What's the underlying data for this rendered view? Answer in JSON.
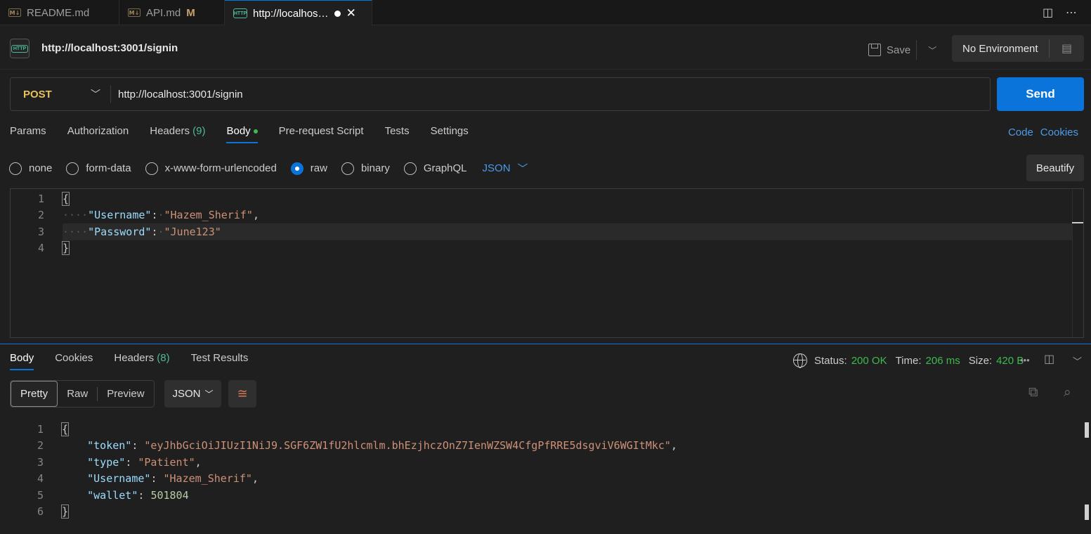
{
  "tabs": [
    {
      "label": "README.md",
      "icon": "markdown-icon"
    },
    {
      "label": "API.md",
      "icon": "markdown-icon",
      "badge": "M"
    },
    {
      "label": "http://localhos…",
      "icon": "http-icon",
      "active": true
    }
  ],
  "request": {
    "title": "http://localhost:3001/signin",
    "save_label": "Save",
    "environment": "No Environment",
    "method": "POST",
    "url": "http://localhost:3001/signin",
    "send_label": "Send"
  },
  "request_tabs": {
    "params": "Params",
    "authorization": "Authorization",
    "headers": "Headers",
    "headers_count": "(9)",
    "body": "Body",
    "prerequest": "Pre-request Script",
    "tests": "Tests",
    "settings": "Settings",
    "code_link": "Code",
    "cookies_link": "Cookies"
  },
  "body_types": {
    "none": "none",
    "form_data": "form-data",
    "urlencoded": "x-www-form-urlencoded",
    "raw": "raw",
    "binary": "binary",
    "graphql": "GraphQL",
    "selected": "raw",
    "format": "JSON",
    "beautify": "Beautify"
  },
  "request_body": {
    "line_numbers": [
      "1",
      "2",
      "3",
      "4"
    ],
    "open": "{",
    "close": "}",
    "username_key": "\"Username\"",
    "username_value": "\"Hazem_Sherif\"",
    "password_key": "\"Password\"",
    "password_value": "\"June123\""
  },
  "response_tabs": {
    "body": "Body",
    "cookies": "Cookies",
    "headers": "Headers",
    "headers_count": "(8)",
    "test_results": "Test Results"
  },
  "response_meta": {
    "status_label": "Status:",
    "status_value": "200 OK",
    "time_label": "Time:",
    "time_value": "206 ms",
    "size_label": "Size:",
    "size_value": "420 B"
  },
  "response_view": {
    "pretty": "Pretty",
    "raw": "Raw",
    "preview": "Preview",
    "format": "JSON"
  },
  "response_body": {
    "line_numbers": [
      "1",
      "2",
      "3",
      "4",
      "5",
      "6"
    ],
    "open": "{",
    "close": "}",
    "token_key": "\"token\"",
    "token_value": "\"eyJhbGciOiJIUzI1NiJ9.SGF6ZW1fU2hlcmlm.bhEzjhczOnZ7IenWZSW4CfgPfRRE5dsgviV6WGItMkc\"",
    "type_key": "\"type\"",
    "type_value": "\"Patient\"",
    "username_key": "\"Username\"",
    "username_value": "\"Hazem_Sherif\"",
    "wallet_key": "\"wallet\"",
    "wallet_value": "501804"
  },
  "colors": {
    "accent": "#0a74da",
    "method": "#e7c25c",
    "success": "#3fb950",
    "json_key": "#9cdcfe",
    "json_string": "#ce9178",
    "json_number": "#b5cea8"
  }
}
